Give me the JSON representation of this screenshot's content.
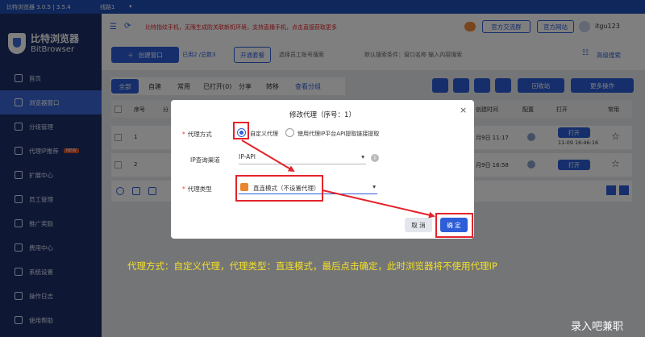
{
  "titlebar": {
    "app": "比特浏览器 3.0.5 | 3.5.4",
    "route": "线路1",
    "notice": "比特指纹手机，无限生成防关联新机环境，支持直播手机，点击直接获取更多",
    "service": "官方交流群",
    "website": "官方网站",
    "user": "itgu123"
  },
  "logo": {
    "cn": "比特浏览器",
    "en": "BitBrowser"
  },
  "nav": [
    {
      "label": "首页"
    },
    {
      "label": "浏览器窗口"
    },
    {
      "label": "分组管理"
    },
    {
      "label": "代理IP推荐",
      "badge": "NEW"
    },
    {
      "label": "扩展中心"
    },
    {
      "label": "员工管理"
    },
    {
      "label": "推广奖励"
    },
    {
      "label": "费用中心"
    },
    {
      "label": "系统设置"
    },
    {
      "label": "操作日志"
    },
    {
      "label": "使用帮助"
    }
  ],
  "toolbar": {
    "create": "创建窗口",
    "opened": "已用2 /总数3",
    "open_pkg": "开通套餐",
    "staff_placeholder": "选择员工账号搜索",
    "search_placeholder": "默认搜索条件：窗口名称 输入内容搜索",
    "advanced": "高级搜索"
  },
  "tabs": [
    "全部",
    "自建",
    "常用",
    "已打开(0)",
    "分享",
    "转移"
  ],
  "view_group": "查看分组",
  "actions": {
    "recycle": "回收站",
    "more": "更多操作"
  },
  "table": {
    "headers": [
      "序号",
      "分",
      "",
      "",
      "",
      "",
      "创建时间",
      "配置",
      "打开",
      "常用"
    ],
    "rows": [
      {
        "index": "1",
        "time": "月9日 11:17",
        "open": "打开",
        "opened_at": "11-09 16:46:16"
      },
      {
        "index": "2",
        "time": "月9日 16:58",
        "open": "打开"
      }
    ]
  },
  "dialog": {
    "title": "修改代理（序号：1）",
    "proxy_method_label": "代理方式",
    "custom_proxy": "自定义代理",
    "api_proxy": "使用代理IP平台API提取链接提取",
    "ip_channel_label": "IP查询渠道",
    "ip_channel_value": "IP-API",
    "proxy_type_label": "代理类型",
    "proxy_type_value": "直连模式（不设置代理）",
    "cancel": "取 消",
    "confirm": "确 定"
  },
  "note": "代理方式：自定义代理，代理类型：直连模式，最后点击确定，此时浏览器将不使用代理IP",
  "watermark": "录入吧兼职",
  "colors": {
    "primary": "#2d5ed8",
    "sidebar": "#1d2e66",
    "annotation": "#e3232b",
    "note": "#f2e02a"
  }
}
